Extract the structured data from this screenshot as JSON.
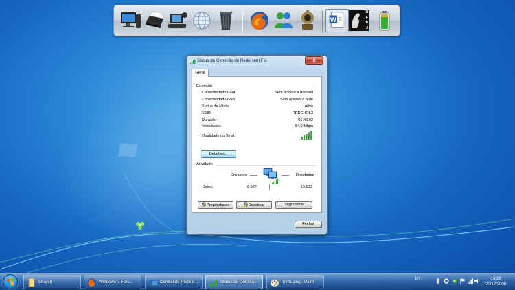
{
  "dialog": {
    "title": "Status de Conexão de Rede sem Fio",
    "close_glyph": "x",
    "tab_label": "Geral",
    "connection": {
      "heading": "Conexão",
      "rows": [
        {
          "label": "Conectividade IPv4:",
          "value": "Sem acesso à Internet"
        },
        {
          "label": "Conectividade IPv6:",
          "value": "Sem acesso à rede"
        },
        {
          "label": "Status da Mídia:",
          "value": "Ativo"
        },
        {
          "label": "SSID:",
          "value": "REDEHOL3"
        },
        {
          "label": "Duração:",
          "value": "01:46:02"
        },
        {
          "label": "Velocidade:",
          "value": "54,0 Mbps"
        }
      ],
      "signal_label": "Qualidade do Sinal:",
      "signal_bars_lit": 5,
      "signal_bars_total": 5,
      "details_button": "Detalhes..."
    },
    "activity": {
      "heading": "Atividade",
      "sent_label": "Enviados",
      "received_label": "Recebidos",
      "bytes_label": "Bytes:",
      "bytes_sent": "8.627",
      "bytes_received": "15.833"
    },
    "buttons": {
      "properties": "Propriedades",
      "disable": "Desativar",
      "diagnose": "Diagnosticar",
      "close": "Fechar"
    }
  },
  "dock": {
    "icons": [
      "computer-icon",
      "printer-icon",
      "network-devices-icon",
      "internet-globe-icon",
      "recycle-bin-icon",
      "firefox-icon",
      "messenger-icon",
      "steampunk-app-icon",
      "word-document-icon",
      "ufrj-logo-icon",
      "battery-icon"
    ],
    "ufrj_letters": "UFRJ"
  },
  "taskbar": {
    "items": [
      {
        "label": "Shared",
        "icon": "folder-icon"
      },
      {
        "label": "Windows 7 Foru...",
        "icon": "firefox-icon"
      },
      {
        "label": "Central de Rede e ...",
        "icon": "network-center-icon"
      },
      {
        "label": "Status de Conexã...",
        "icon": "wireless-signal-icon"
      },
      {
        "label": "print1.png - Paint",
        "icon": "paint-icon"
      }
    ],
    "tray": {
      "language": "PT",
      "time": "14:29",
      "date": "20/12/2009"
    }
  },
  "colors": {
    "desktop_blue": "#1464c0",
    "signal_green": "#2fa52f",
    "close_red": "#c7513c"
  }
}
